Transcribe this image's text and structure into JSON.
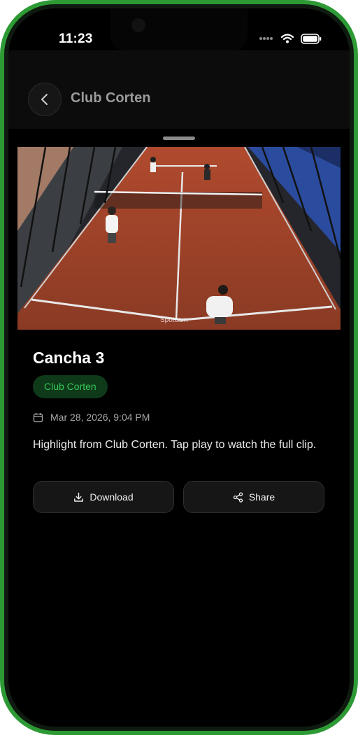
{
  "status_bar": {
    "time": "11:23"
  },
  "header": {
    "title": "Club Corten"
  },
  "video": {
    "watermark": "Spotcam"
  },
  "clip": {
    "title": "Cancha 3",
    "club_chip": "Club Corten",
    "date": "Mar 28, 2026, 9:04 PM",
    "description": "Highlight from Club Corten. Tap play to watch the full clip."
  },
  "actions": {
    "download_label": "Download",
    "share_label": "Share"
  },
  "colors": {
    "accent": "#34c759",
    "chip_bg": "#0f3a19",
    "frame": "#2d9a35"
  },
  "icons": [
    "back-icon",
    "wifi-icon",
    "battery-icon",
    "calendar-icon",
    "download-icon",
    "share-icon"
  ]
}
